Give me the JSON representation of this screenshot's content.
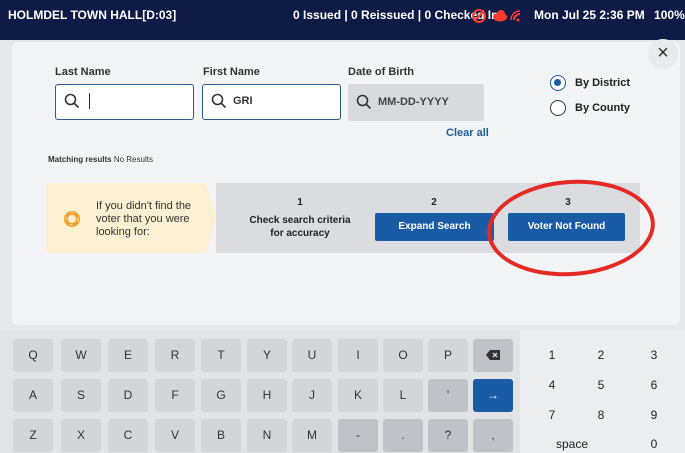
{
  "status_bar": {
    "location": "HOLMDEL TOWN HALL[D:03]",
    "counts": "0 Issued | 0 Reissued | 0 Checked In",
    "datetime": "Mon Jul 25  2:36 PM",
    "battery": "100%"
  },
  "search": {
    "last_name": {
      "label": "Last Name",
      "value": "",
      "placeholder": ""
    },
    "first_name": {
      "label": "First Name",
      "value": "GRI"
    },
    "dob": {
      "label": "Date of Birth",
      "placeholder": "MM-DD-YYYY"
    },
    "clear_all": "Clear all"
  },
  "scope": {
    "options": [
      "By District",
      "By County"
    ],
    "selected": "By District"
  },
  "results": {
    "label": "Matching results",
    "value": "No Results"
  },
  "help": {
    "text": "If you didn't find the voter that you were looking for:",
    "steps": [
      {
        "number": "1",
        "text": "Check search criteria for accuracy"
      },
      {
        "number": "2",
        "button": "Expand Search"
      },
      {
        "number": "3",
        "button": "Voter Not Found"
      }
    ]
  },
  "keyboard": {
    "row1": [
      "Q",
      "W",
      "E",
      "R",
      "T",
      "Y",
      "U",
      "I",
      "O",
      "P"
    ],
    "row2": [
      "A",
      "S",
      "D",
      "F",
      "G",
      "H",
      "J",
      "K",
      "L",
      "'"
    ],
    "row3": [
      "Z",
      "X",
      "C",
      "V",
      "B",
      "N",
      "M",
      "-",
      ".",
      "?",
      ","
    ],
    "enter": "→",
    "numpad": [
      "1",
      "2",
      "3",
      "4",
      "5",
      "6",
      "7",
      "8",
      "9",
      "space",
      "0"
    ]
  },
  "colors": {
    "status_bar": "#0f1b46",
    "primary_button": "#1a5ba6",
    "highlight_ring": "#e52a25",
    "help_box": "#fbf0d2"
  }
}
